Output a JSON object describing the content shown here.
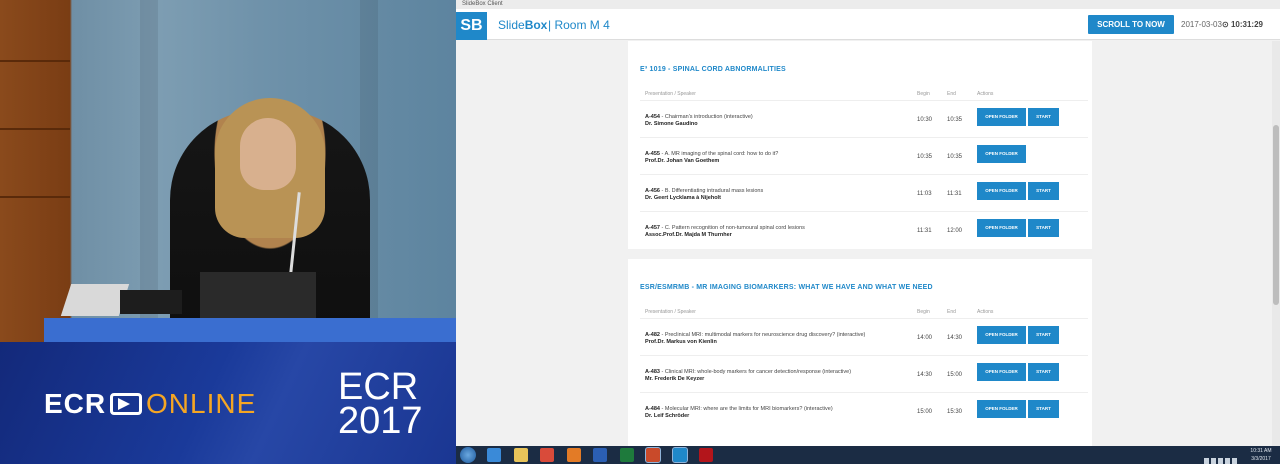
{
  "window": {
    "title": "SlideBox Client"
  },
  "header": {
    "logo": "SB",
    "app_name_light": "Slide",
    "app_name_bold": "Box",
    "room": "| Room M 4",
    "scroll_button": "SCROLL TO NOW",
    "date": "2017-03-03",
    "time": "10:31:29"
  },
  "columns": {
    "presentation": "Presentation / Speaker",
    "begin": "Begin",
    "end": "End",
    "actions": "Actions"
  },
  "sections": [
    {
      "title": "E³ 1019 - SPINAL CORD ABNORMALITIES",
      "rows": [
        {
          "code": "A-454",
          "title": "Chairman's introduction (interactive)",
          "speaker": "Dr. Simone Gaudino",
          "begin": "10:30",
          "end": "10:35",
          "open_label": "OPEN FOLDER",
          "start_label": "START",
          "has_start": true
        },
        {
          "code": "A-455",
          "title": "A. MR imaging of the spinal cord: how to do it?",
          "speaker": "Prof.Dr. Johan Van Goethem",
          "begin": "10:35",
          "end": "10:35",
          "open_label": "OPEN FOLDER",
          "start_label": "",
          "has_start": false
        },
        {
          "code": "A-456",
          "title": "B. Differentiating intradural mass lesions",
          "speaker": "Dr. Geert Lycklama à Nijeholt",
          "begin": "11:03",
          "end": "11:31",
          "open_label": "OPEN FOLDER",
          "start_label": "START",
          "has_start": true
        },
        {
          "code": "A-457",
          "title": "C. Pattern recognition of non-tumoural spinal cord lesions",
          "speaker": "Assoc.Prof.Dr. Majda M Thurnher",
          "begin": "11:31",
          "end": "12:00",
          "open_label": "OPEN FOLDER",
          "start_label": "START",
          "has_start": true
        }
      ]
    },
    {
      "title": "ESR/ESMRMB - MR IMAGING BIOMARKERS: WHAT WE HAVE AND WHAT WE NEED",
      "rows": [
        {
          "code": "A-482",
          "title": "Preclinical MRI: multimodal markers for neuroscience drug discovery? (interactive)",
          "speaker": "Prof.Dr. Markus von Kienlin",
          "begin": "14:00",
          "end": "14:30",
          "open_label": "OPEN FOLDER",
          "start_label": "START",
          "has_start": true
        },
        {
          "code": "A-483",
          "title": "Clinical MRI: whole-body markers for cancer detection/response (interactive)",
          "speaker": "Mr. Frederik De Keyzer",
          "begin": "14:30",
          "end": "15:00",
          "open_label": "OPEN FOLDER",
          "start_label": "START",
          "has_start": true
        },
        {
          "code": "A-484",
          "title": "Molecular MRI: where are the limits for MRI biomarkers? (interactive)",
          "speaker": "Dr. Leif Schröder",
          "begin": "15:00",
          "end": "15:30",
          "open_label": "OPEN FOLDER",
          "start_label": "START",
          "has_start": true
        }
      ]
    }
  ],
  "branding": {
    "ecr": "ECR",
    "online": "ONLINE",
    "year_line1": "ECR",
    "year_line2": "2017"
  },
  "taskbar": {
    "apps": [
      {
        "icon": "ie-icon",
        "color": "#3a8ad8"
      },
      {
        "icon": "folder-icon",
        "color": "#e8c45a"
      },
      {
        "icon": "chrome-icon",
        "color": "#d94b3a"
      },
      {
        "icon": "firefox-icon",
        "color": "#e37b26"
      },
      {
        "icon": "word-icon",
        "color": "#2b5fb4"
      },
      {
        "icon": "excel-icon",
        "color": "#1e7a3c"
      },
      {
        "icon": "powerpoint-icon",
        "color": "#c94a2a"
      },
      {
        "icon": "slidebox-icon",
        "color": "#1f88c9"
      },
      {
        "icon": "acrobat-icon",
        "color": "#b3151b"
      }
    ],
    "time": "10:31 AM",
    "date": "3/3/2017"
  },
  "colors": {
    "accent": "#1f88c9",
    "banner": "#1a3a9a",
    "online": "#f5a623"
  }
}
